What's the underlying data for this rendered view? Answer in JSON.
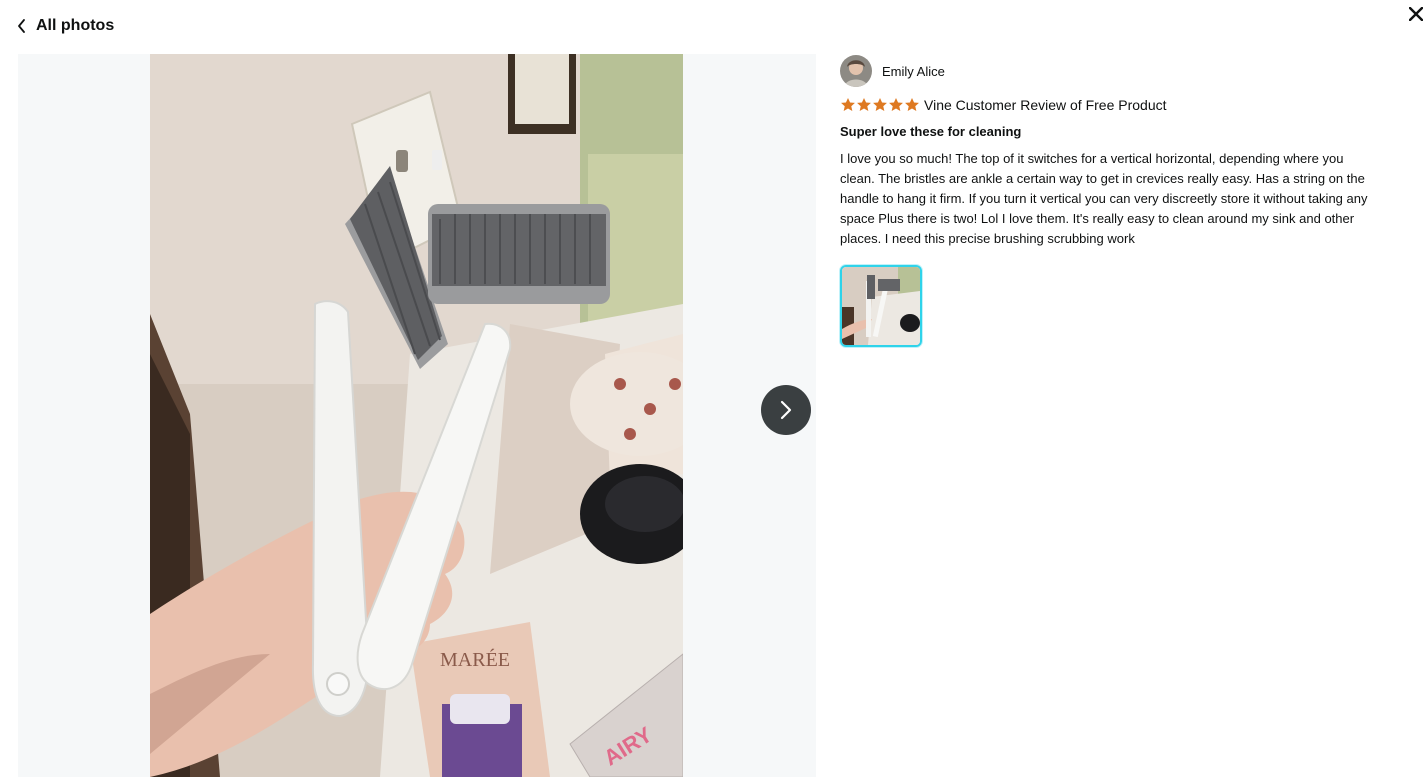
{
  "header": {
    "back_label": "All photos",
    "back_icon": "chevron-left-icon",
    "close_icon": "close-icon"
  },
  "viewer": {
    "next_icon": "chevron-right-icon",
    "photo_text": {
      "box_brand": "MARÉE",
      "box_corner": "AIRY"
    }
  },
  "review": {
    "author_name": "Emily Alice",
    "rating_stars": 5,
    "star_color": "#de7921",
    "rating_label": "Vine Customer Review of Free Product",
    "title": "Super love these for cleaning",
    "body": "I love you so much! The top of it switches for a vertical horizontal, depending where you clean. The bristles are ankle a certain way to get in crevices really easy. Has a string on the handle to hang it firm. If you turn it vertical you can very discreetly store it without taking any space Plus there is two! Lol I love them. It's really easy to clean around my sink and other places. I need this precise brushing scrubbing work",
    "thumbnail_count": 1,
    "selected_thumb_border": "#2fd3ea"
  }
}
